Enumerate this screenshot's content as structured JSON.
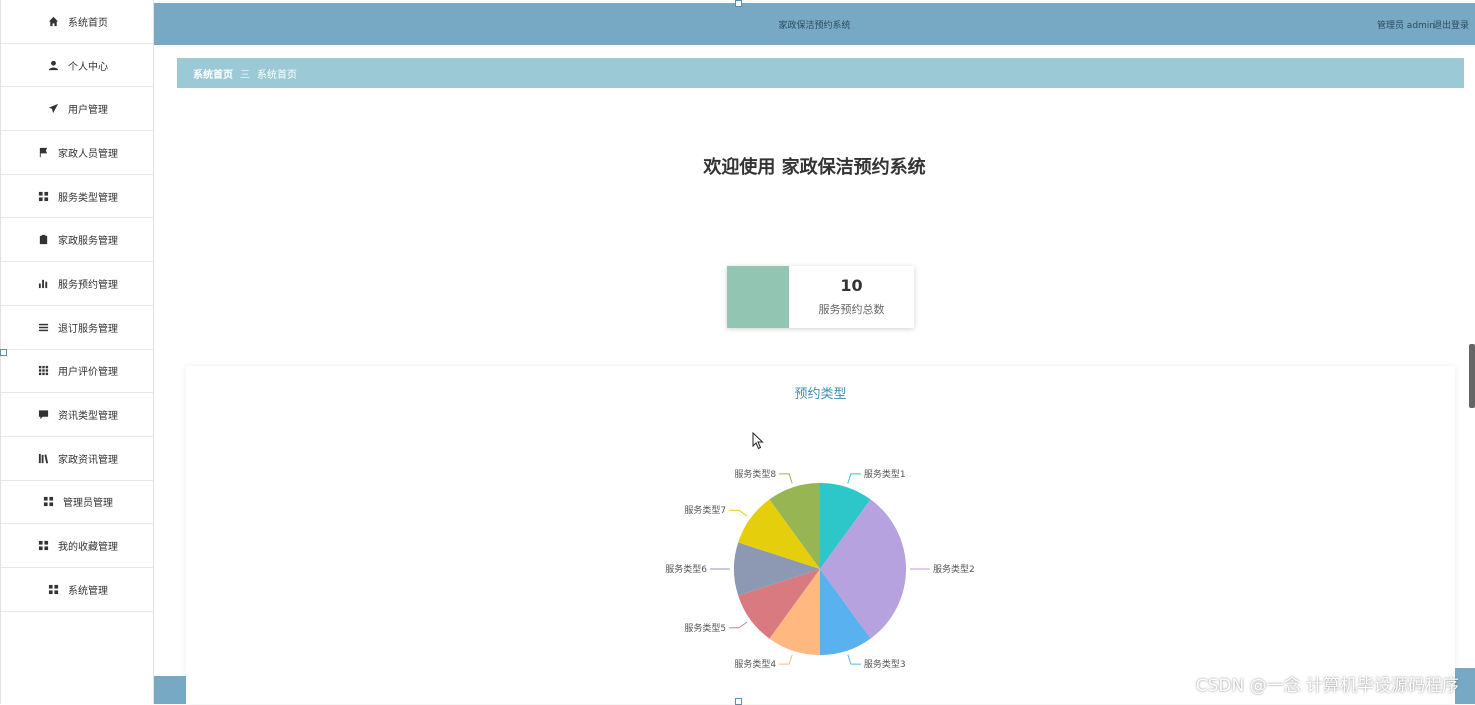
{
  "sidebar": {
    "items": [
      {
        "label": "系统首页",
        "icon": "home-icon"
      },
      {
        "label": "个人中心",
        "icon": "user-icon"
      },
      {
        "label": "用户管理",
        "icon": "send-icon"
      },
      {
        "label": "家政人员管理",
        "icon": "flag-icon"
      },
      {
        "label": "服务类型管理",
        "icon": "grid-icon"
      },
      {
        "label": "家政服务管理",
        "icon": "clipboard-icon"
      },
      {
        "label": "服务预约管理",
        "icon": "bar-chart-icon"
      },
      {
        "label": "退订服务管理",
        "icon": "list-icon"
      },
      {
        "label": "用户评价管理",
        "icon": "apps-icon"
      },
      {
        "label": "资讯类型管理",
        "icon": "comment-icon"
      },
      {
        "label": "家政资讯管理",
        "icon": "library-icon"
      },
      {
        "label": "管理员管理",
        "icon": "grid-icon"
      },
      {
        "label": "我的收藏管理",
        "icon": "grid-icon"
      },
      {
        "label": "系统管理",
        "icon": "grid-icon"
      }
    ]
  },
  "header": {
    "title": "家政保洁预约系统",
    "user": "管理员 admin",
    "logout": "退出登录"
  },
  "breadcrumb": {
    "root": "系统首页",
    "separator": "三",
    "current": "系统首页"
  },
  "welcome": "欢迎使用 家政保洁预约系统",
  "stat": {
    "value": "10",
    "label": "服务预约总数",
    "color": "#93c6b2"
  },
  "chart_title": "预约类型",
  "chart_data": {
    "type": "pie",
    "title": "预约类型",
    "categories": [
      "服务类型1",
      "服务类型2",
      "服务类型3",
      "服务类型4",
      "服务类型5",
      "服务类型6",
      "服务类型7",
      "服务类型8"
    ],
    "values": [
      1,
      3,
      1,
      1,
      1,
      1,
      1,
      1
    ],
    "colors": [
      "#2ec7c9",
      "#b6a2de",
      "#5ab1ef",
      "#ffb980",
      "#d87a80",
      "#8d98b3",
      "#e5cf0d",
      "#97b552"
    ]
  },
  "watermark": "CSDN @一念 计算机毕设源码程序"
}
